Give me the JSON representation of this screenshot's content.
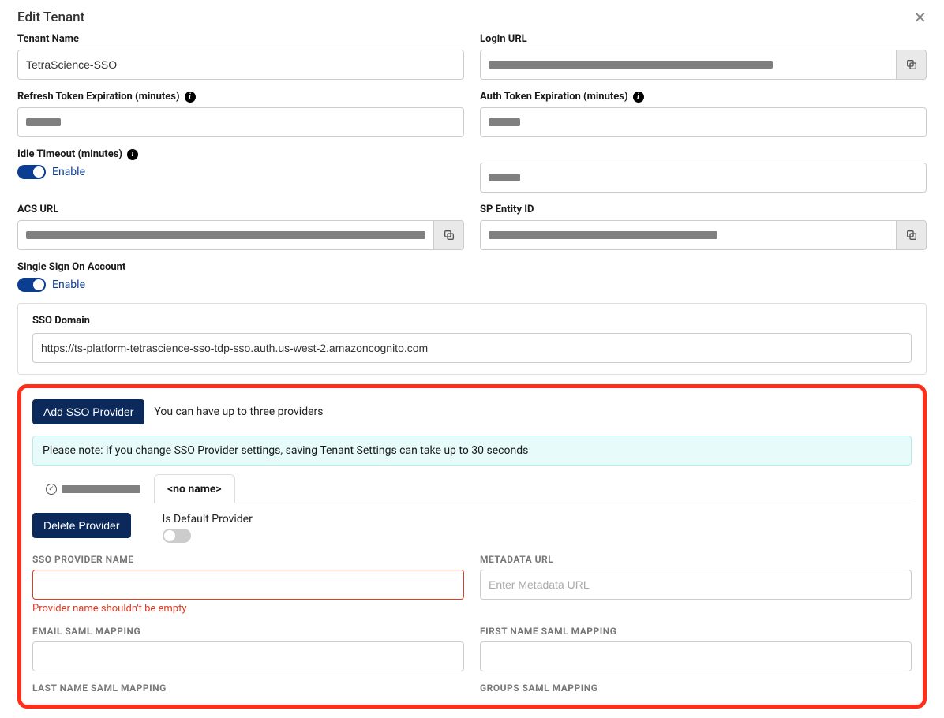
{
  "header": {
    "title": "Edit Tenant"
  },
  "left": {
    "tenant_name_label": "Tenant Name",
    "tenant_name_value": "TetraScience-SSO",
    "refresh_label": "Refresh Token Expiration (minutes)",
    "idle_label": "Idle Timeout (minutes)",
    "acs_label": "ACS URL",
    "sso_account_label": "Single Sign On Account",
    "enable_text": "Enable"
  },
  "right": {
    "login_url_label": "Login URL",
    "auth_label": "Auth Token Expiration (minutes)",
    "sp_entity_label": "SP Entity ID"
  },
  "panel": {
    "sso_domain_label": "SSO Domain",
    "sso_domain_value": "https://ts-platform-tetrascience-sso-tdp-sso.auth.us-west-2.amazoncognito.com"
  },
  "providers": {
    "add_btn": "Add SSO Provider",
    "add_hint": "You can have up to three providers",
    "note": "Please note: if you change SSO Provider settings, saving Tenant Settings can take up to 30 seconds",
    "tab2": "<no name>",
    "delete_btn": "Delete Provider",
    "is_default_label": "Is Default Provider",
    "name_label": "SSO PROVIDER NAME",
    "name_error": "Provider name shouldn't be empty",
    "metadata_label": "METADATA URL",
    "metadata_placeholder": "Enter Metadata URL",
    "email_label": "EMAIL SAML MAPPING",
    "first_label": "FIRST NAME SAML MAPPING",
    "last_label": "LAST NAME SAML MAPPING",
    "groups_label": "GROUPS SAML MAPPING"
  }
}
